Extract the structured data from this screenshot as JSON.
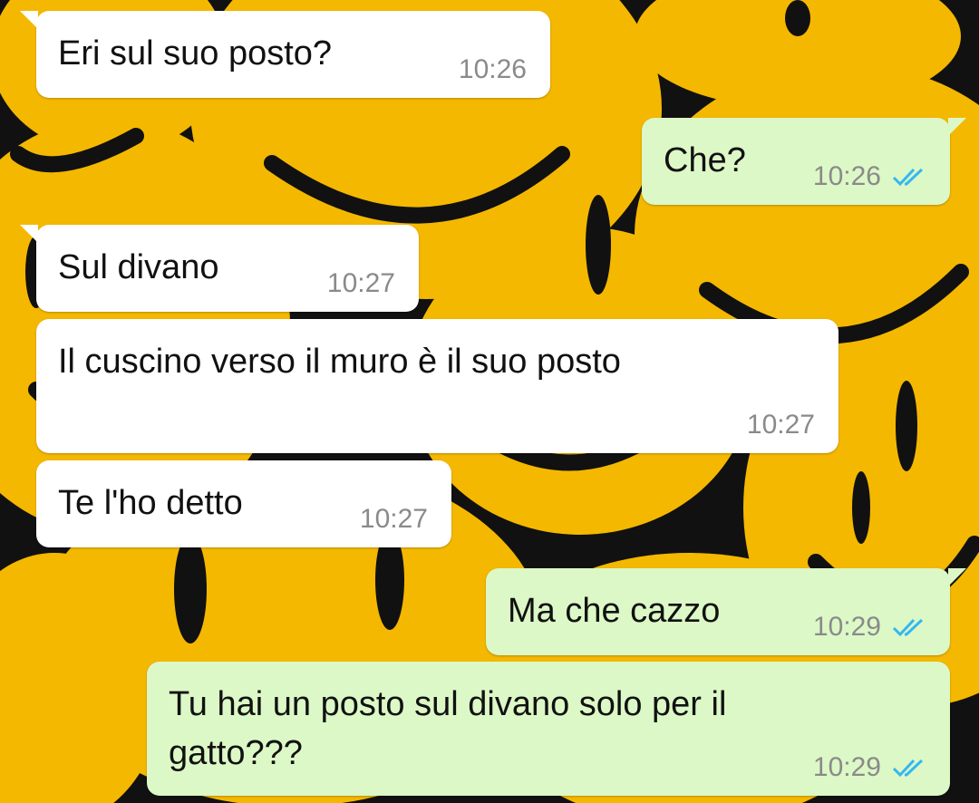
{
  "chat": {
    "messages": [
      {
        "direction": "incoming",
        "text": "Eri sul suo posto?",
        "time": "10:26"
      },
      {
        "direction": "outgoing",
        "text": "Che?",
        "time": "10:26",
        "status": "read-double-check-icon"
      },
      {
        "direction": "incoming",
        "text": "Sul divano",
        "time": "10:27"
      },
      {
        "direction": "incoming",
        "text": "Il cuscino verso il muro è il suo posto",
        "time": "10:27"
      },
      {
        "direction": "incoming",
        "text": "Te l'ho detto",
        "time": "10:27"
      },
      {
        "direction": "outgoing",
        "text": "Ma che cazzo",
        "time": "10:29",
        "status": "read-double-check-icon"
      },
      {
        "direction": "outgoing",
        "text": "Tu hai un posto sul divano solo per il gatto???",
        "time": "10:29",
        "status": "read-double-check-icon"
      }
    ]
  },
  "colors": {
    "incoming_bubble": "#ffffff",
    "outgoing_bubble": "#dcf8c6",
    "read_ticks": "#34b7f1",
    "wallpaper_yellow": "#f5b800",
    "wallpaper_black": "#111111"
  }
}
